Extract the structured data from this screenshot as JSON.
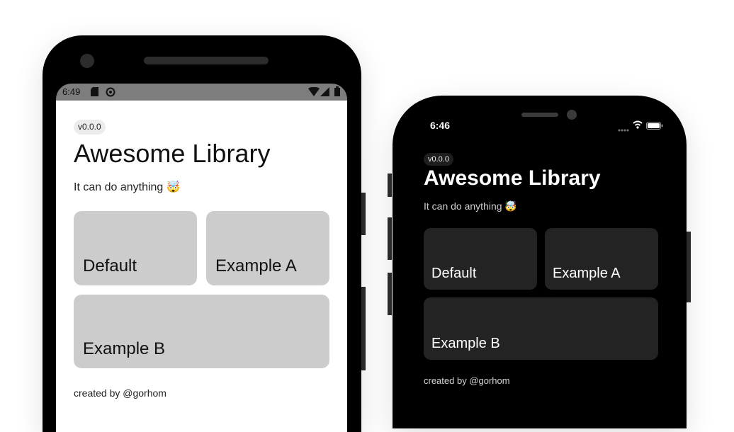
{
  "android": {
    "status_time": "6:49",
    "status_icons": [
      "sd-card-icon",
      "sync-icon",
      "wifi-icon",
      "signal-icon",
      "battery-icon"
    ],
    "badge": "v0.0.0",
    "title": "Awesome Library",
    "subtitle": "It can do anything",
    "subtitle_emoji": "🤯",
    "cards": [
      {
        "label": "Default"
      },
      {
        "label": "Example A"
      },
      {
        "label": "Example B"
      }
    ],
    "footer": "created by @gorhom",
    "colors": {
      "screen": "#ffffff",
      "card": "#cccccc",
      "statusbar": "#7d7d7d"
    }
  },
  "ios": {
    "status_time": "6:46",
    "status_icons": [
      "signal-dots-icon",
      "wifi-icon",
      "battery-icon"
    ],
    "badge": "v0.0.0",
    "title": "Awesome Library",
    "subtitle": "It can do anything",
    "subtitle_emoji": "🤯",
    "cards": [
      {
        "label": "Default"
      },
      {
        "label": "Example A"
      },
      {
        "label": "Example B"
      }
    ],
    "footer": "created by @gorhom",
    "colors": {
      "screen": "#000000",
      "card": "#232323"
    }
  }
}
